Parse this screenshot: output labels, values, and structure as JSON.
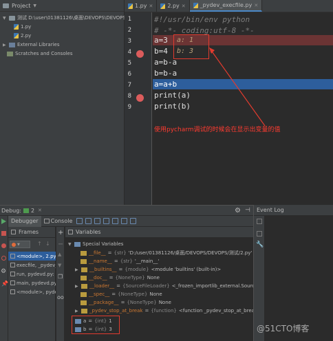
{
  "project": {
    "header": "Project",
    "tree": [
      {
        "label": "测试 D:\\user\\01381126\\桌面\\DEVOPS\\DEVOPS\\",
        "indent": 0
      },
      {
        "label": "1.py",
        "indent": 1
      },
      {
        "label": "2.py",
        "indent": 1
      },
      {
        "label": "External Libraries",
        "indent": 0
      },
      {
        "label": "Scratches and Consoles",
        "indent": 0
      }
    ]
  },
  "editor": {
    "tabs": [
      {
        "label": "1.py",
        "active": false
      },
      {
        "label": "2.py",
        "active": false
      },
      {
        "label": "_pydev_execfile.py",
        "active": true
      }
    ],
    "lines": [
      {
        "num": "1",
        "text": "#!/usr/bin/env python"
      },
      {
        "num": "2",
        "text": "# -*- coding:utf-8 -*-"
      },
      {
        "num": "3",
        "text": "a=3"
      },
      {
        "num": "4",
        "text": "b=4"
      },
      {
        "num": "5",
        "text": "a=b-a"
      },
      {
        "num": "6",
        "text": "b=b-a"
      },
      {
        "num": "7",
        "text": "a=a+b"
      },
      {
        "num": "8",
        "text": "print(a)"
      },
      {
        "num": "9",
        "text": "print(b)"
      }
    ],
    "inline_hints": [
      "a: 1",
      "b: 3"
    ],
    "annotation": "使用pycharm调试的时候会在显示出变量的值"
  },
  "debug": {
    "title": "Debug:",
    "run_tab": "2",
    "tabs": [
      "Debugger",
      "Console"
    ],
    "frames_header": "Frames",
    "variables_header": "Variables",
    "frames": [
      {
        "label": "<module>, 2.py",
        "selected": true
      },
      {
        "label": "execfile, _pydev_",
        "selected": false
      },
      {
        "label": "run, pydevd.py:",
        "selected": false
      },
      {
        "label": "main, pydevd.py:",
        "selected": false
      },
      {
        "label": "<module>, pydev",
        "selected": false
      }
    ],
    "variables": [
      {
        "name": "Special Variables",
        "type": "",
        "value": ""
      },
      {
        "name": "__file__",
        "type": "{str}",
        "value": "'D:/user/01381126/桌面/DEVOPS/DEVOPS/测试/2.py'"
      },
      {
        "name": "__name__",
        "type": "{str}",
        "value": "'__main__'"
      },
      {
        "name": "__builtins__",
        "type": "{module}",
        "value": "<module 'builtins' (built-in)>"
      },
      {
        "name": "__doc__",
        "type": "{NoneType}",
        "value": "None"
      },
      {
        "name": "__loader__",
        "type": "{SourceFileLoader}",
        "value": "<_frozen_importlib_external.SourceFil"
      },
      {
        "name": "__spec__",
        "type": "{NoneType}",
        "value": "None"
      },
      {
        "name": "__package__",
        "type": "{NoneType}",
        "value": "None"
      },
      {
        "name": "_pydev_stop_at_break",
        "type": "{function}",
        "value": "<function _pydev_stop_at_break a"
      },
      {
        "name": "a",
        "type": "{int}",
        "value": "1"
      },
      {
        "name": "b",
        "type": "{int}",
        "value": "3"
      }
    ]
  },
  "event_log": {
    "title": "Event Log"
  },
  "watermark": "@51CTO博客",
  "colors": {
    "breakpoint": "#db5c5c",
    "current_line": "#2d5e9c",
    "annotation": "#e23b2e"
  }
}
